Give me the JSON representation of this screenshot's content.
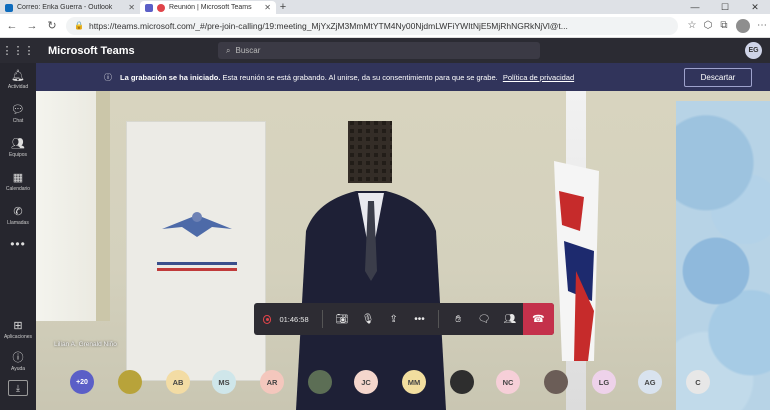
{
  "browser": {
    "tabs": [
      {
        "title": "Correo: Erika Guerra - Outlook",
        "active": false
      },
      {
        "title": "Reunión | Microsoft Teams",
        "active": true
      }
    ],
    "url": "https://teams.microsoft.com/_#/pre-join-calling/19:meeting_MjYxZjM3MmMtYTM4Ny00NjdmLWFiYWItNjE5MjRhNGRkNjVl@t..."
  },
  "teams": {
    "brand": "Microsoft Teams",
    "search_placeholder": "Buscar",
    "user_initials": "EG"
  },
  "rail": {
    "items": [
      {
        "label": "Actividad",
        "icon": "bell-icon"
      },
      {
        "label": "Chat",
        "icon": "chat-icon"
      },
      {
        "label": "Equipos",
        "icon": "teams-icon"
      },
      {
        "label": "Calendario",
        "icon": "calendar-icon"
      },
      {
        "label": "Llamadas",
        "icon": "phone-icon"
      }
    ],
    "more": "•••",
    "bottom": [
      {
        "label": "Aplicaciones",
        "icon": "apps-icon"
      },
      {
        "label": "Ayuda",
        "icon": "help-icon"
      }
    ]
  },
  "notice": {
    "bold": "La grabación se ha iniciado.",
    "text": "Esta reunión se está grabando. Al unirse, da su consentimiento para que se grabe.",
    "link": "Política de privacidad",
    "dismiss": "Descartar"
  },
  "video": {
    "caption": "Lilian A. Grenald Niño"
  },
  "controls": {
    "timer": "01:46:58"
  },
  "participants": [
    {
      "label": "+20",
      "type": "more",
      "color": "#5b5fc7"
    },
    {
      "label": "",
      "type": "photo",
      "color": "#b8a33a"
    },
    {
      "label": "AB",
      "type": "initials",
      "color": "#f3dca4"
    },
    {
      "label": "MS",
      "type": "initials",
      "color": "#cfe6ea"
    },
    {
      "label": "AR",
      "type": "initials",
      "color": "#f4c7bd"
    },
    {
      "label": "",
      "type": "photo",
      "color": "#5c6e55"
    },
    {
      "label": "JC",
      "type": "initials",
      "color": "#f4d6cc"
    },
    {
      "label": "MM",
      "type": "initials",
      "color": "#f2de9f"
    },
    {
      "label": "",
      "type": "photo",
      "color": "#2e2e2e"
    },
    {
      "label": "NC",
      "type": "initials",
      "color": "#f6cfd8"
    },
    {
      "label": "",
      "type": "photo",
      "color": "#6b5d57"
    },
    {
      "label": "LG",
      "type": "initials",
      "color": "#eed2ea"
    },
    {
      "label": "AG",
      "type": "initials",
      "color": "#d9e3ef"
    },
    {
      "label": "C",
      "type": "initials",
      "color": "#e7e7e7"
    }
  ]
}
